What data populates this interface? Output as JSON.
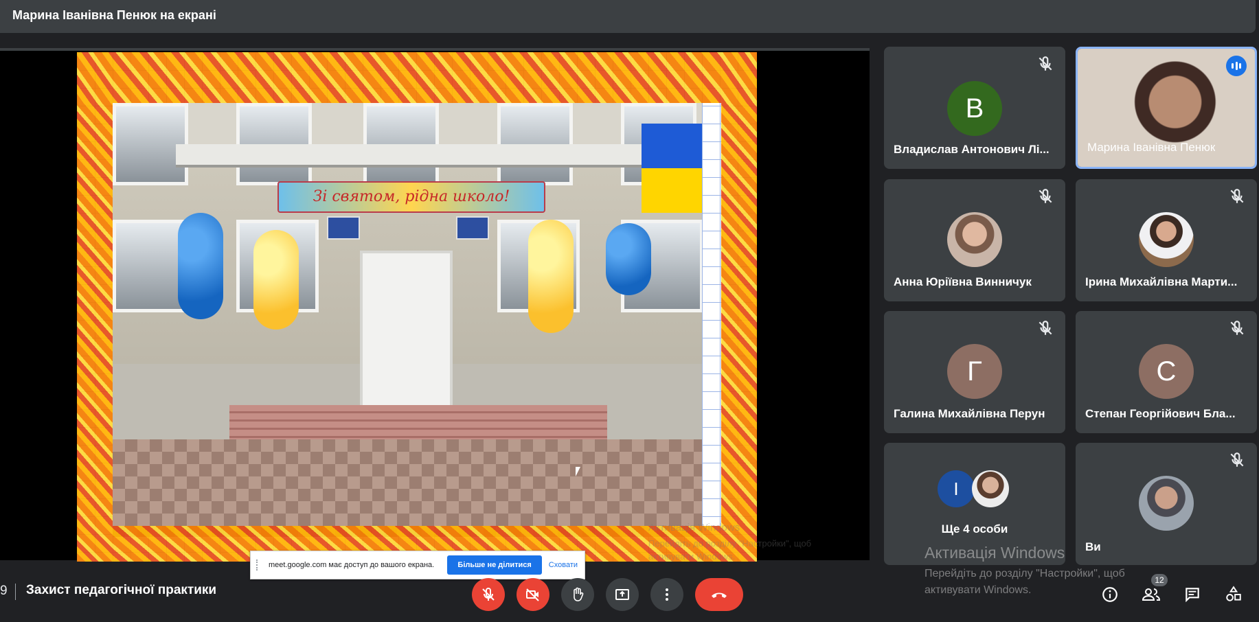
{
  "presenter_bar": {
    "title": "Марина Іванівна Пенюк на екрані"
  },
  "slide": {
    "banner_text": "Зі святом, рідна школо!"
  },
  "share_notice": {
    "message": "meet.google.com має доступ до вашого екрана.",
    "stop_label": "Більше не ділитися",
    "hide_label": "Сховати"
  },
  "participants": [
    {
      "name": "Владислав Антонович Лі...",
      "initial": "В",
      "avatar_color": "#33691e",
      "muted": true
    },
    {
      "name": "Марина Іванівна Пенюк",
      "video": true,
      "speaking": true
    },
    {
      "name": "Анна Юріївна Винничук",
      "photo": true,
      "muted": true
    },
    {
      "name": "Ірина Михайлівна Марти...",
      "photo": true,
      "muted": true
    },
    {
      "name": "Галина Михайлівна Перун",
      "initial": "Г",
      "avatar_color": "#8d6e63",
      "muted": true
    },
    {
      "name": "Степан Георгійович Бла...",
      "initial": "С",
      "avatar_color": "#8d6e63",
      "muted": true
    },
    {
      "name": "Ще 4 особи",
      "group_initial": "І"
    },
    {
      "name": "Ви",
      "photo": true,
      "muted": true
    }
  ],
  "watermark": {
    "title": "Активація Windows",
    "text": "Перейдіть до розділу \"Настройки\", щоб активувати Windows.",
    "shared_title": "Активація Windows",
    "shared_text": "Перейдіть до розділу \"Настройки\", щоб активувати Windows."
  },
  "bottom_bar": {
    "meeting_code_fragment": "9",
    "meeting_name": "Захист педагогічної практики",
    "participant_count": "12",
    "icons": [
      "mic-off-icon",
      "camera-off-icon",
      "raise-hand-icon",
      "present-icon",
      "more-options-icon",
      "hang-up-icon",
      "info-icon",
      "people-icon",
      "chat-icon",
      "activities-icon"
    ]
  },
  "colors": {
    "danger": "#ea4335",
    "accent": "#1a73e8",
    "tile_bg": "#3c4043",
    "page_bg": "#202124"
  }
}
